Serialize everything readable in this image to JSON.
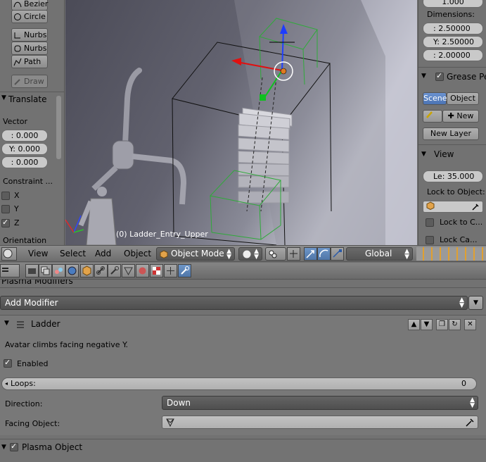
{
  "left_panel": {
    "tools": [
      {
        "label": "Bezier"
      },
      {
        "label": "Circle"
      },
      {
        "label": "Nurbs"
      },
      {
        "label": "Nurbs"
      },
      {
        "label": "Path"
      }
    ],
    "draw_label": "Draw",
    "translate_title": "Translate",
    "vector_label": "Vector",
    "vector_values": [
      ": 0.000",
      "Y: 0.000",
      ": 0.000"
    ],
    "constraint_label": "Constraint ...",
    "axes": [
      {
        "label": "X",
        "checked": false
      },
      {
        "label": "Y",
        "checked": false
      },
      {
        "label": "Z",
        "checked": true
      }
    ],
    "orientation_label": "Orientation"
  },
  "viewport": {
    "object_label": "(0) Ladder_Entry_Upper"
  },
  "right_panel": {
    "top_value": "1.000",
    "dimensions_label": "Dimensions:",
    "dimensions": [
      ": 2.50000",
      "Y: 2.50000",
      ": 2.00000"
    ],
    "grease_label": "Grease Pe",
    "scene_tab": "Scene",
    "object_tab": "Object",
    "new_label": "New",
    "new_layer_label": "New Layer",
    "view_label": "View",
    "lens_value": "Le: 35.000",
    "lock_to_object_label": "Lock to Object:",
    "lock_to_c_label": "Lock to C...",
    "lock_ca_label": "Lock Ca..."
  },
  "view_header": {
    "menus": [
      "View",
      "Select",
      "Add",
      "Object"
    ],
    "mode": "Object Mode",
    "orientation": "Global"
  },
  "properties": {
    "section_title": "Plasma Modifiers",
    "add_modifier_label": "Add Modifier",
    "modifier_name": "Ladder",
    "description": "Avatar climbs facing negative Y.",
    "enabled_label": "Enabled",
    "loops_label": "Loops:",
    "loops_value": "0",
    "direction_label": "Direction:",
    "direction_value": "Down",
    "facing_label": "Facing Object:",
    "plasma_object_label": "Plasma Object"
  },
  "colors": {
    "panel_bg": "#727272",
    "active_tab": "#5680c2",
    "viewport_light": "#c7c8d3"
  }
}
